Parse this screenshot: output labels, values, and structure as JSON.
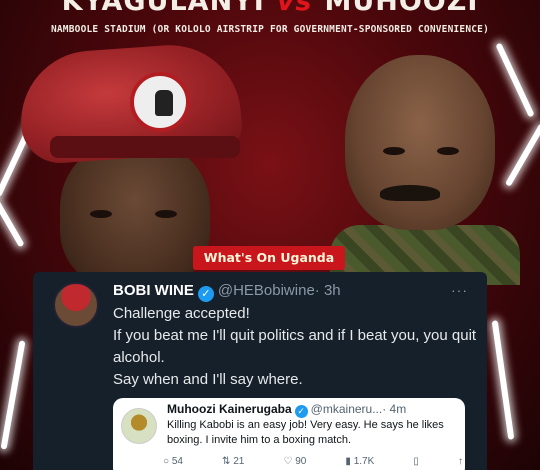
{
  "poster": {
    "left_name": "KYAGULANYI",
    "vs": "vs",
    "right_name": "MUHOOZI",
    "venue": "NAMBOOLE STADIUM (OR KOLOLO AIRSTRIP FOR GOVERNMENT-SPONSORED CONVENIENCE)",
    "watermark": "What's On Uganda",
    "accent_color": "#c9161d"
  },
  "tweet": {
    "name": "BOBI WINE",
    "handle": "@HEBobiwine",
    "time": "· 3h",
    "more": "···",
    "lines": [
      "Challenge accepted!",
      "If you beat me I'll quit politics and if I beat you, you quit alcohol.",
      "Say when and I'll say where."
    ]
  },
  "quoted": {
    "name": "Muhoozi Kainerugaba",
    "handle": "@mkaineru...",
    "time": "· 4m",
    "text": "Killing Kabobi is an easy job! Very easy. He says he likes boxing. I invite him to a boxing match.",
    "actions": {
      "reply_count": "54",
      "retweet_count": "21",
      "like_count": "90",
      "views_count": "1.7K"
    }
  }
}
